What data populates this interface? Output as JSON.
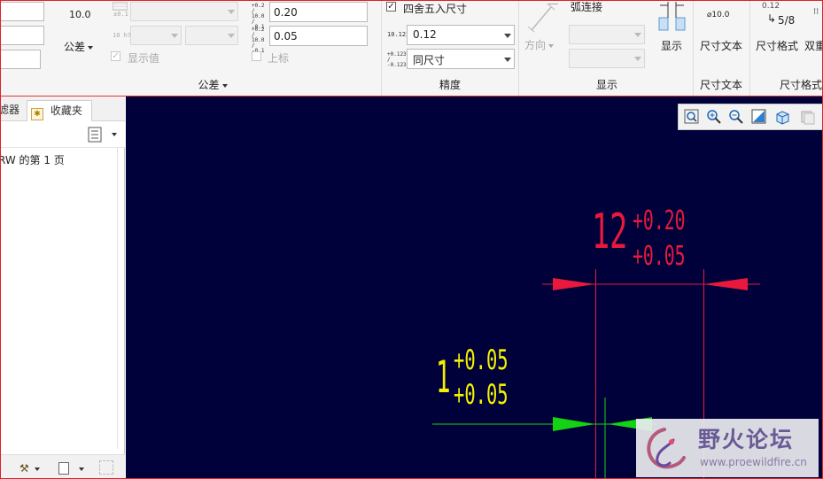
{
  "ribbon": {
    "tolerance_group": {
      "label": "公差",
      "tolerance_button_label": "公差",
      "tolerance_button_value": "10.0",
      "tol_icon_top_text": "±0.1",
      "tol_icon_h7_text": "10 h7",
      "show_value_label": "显示值",
      "upper_icon_text": "+0.2 / 10.0 / -0.1",
      "lower_icon_text": "+0.2 / 10.0 / -0.1",
      "upper_value": "0.20",
      "lower_value": "0.05",
      "superscript_label": "上标"
    },
    "precision_group": {
      "label": "精度",
      "round_label": "四舍五入尺寸",
      "round_checked": true,
      "decimal_icon_text": "10.123",
      "decimal_value": "0.12",
      "tol_format_icon_text": "+0.123 / -0.123",
      "tol_format_value": "同尺寸"
    },
    "display_group": {
      "label": "显示",
      "arc_label": "弧连接",
      "direction_label": "方向",
      "display_button_label": "显示"
    },
    "dim_text_group": {
      "label": "尺寸文本",
      "button_label": "尺寸文本",
      "icon_text": "⌀10.0"
    },
    "dim_format_group": {
      "label": "尺寸格式",
      "button_label": "尺寸格式",
      "second_label": "双重",
      "icon_top_text": "0.12",
      "icon_frac_text": "5/8"
    }
  },
  "left_panel": {
    "tabs": [
      {
        "label": "滤器"
      },
      {
        "label": "收藏夹"
      }
    ],
    "list_items": [
      {
        "label": "RW 的第 1 页"
      }
    ]
  },
  "drawing": {
    "red_dimension": {
      "value": "12",
      "upper": "+0.20",
      "lower": "+0.05"
    },
    "yellow_dimension": {
      "value": "1",
      "upper": "+0.05",
      "lower": "+0.05"
    }
  },
  "watermark": {
    "title": "野火论坛",
    "url": "www.proewildfire.cn"
  },
  "colors": {
    "canvas_bg": "#00003a",
    "red_dim": "#e8193c",
    "yellow_dim": "#f2f200",
    "green_dim": "#14d314",
    "accent_border": "#e2393a"
  }
}
